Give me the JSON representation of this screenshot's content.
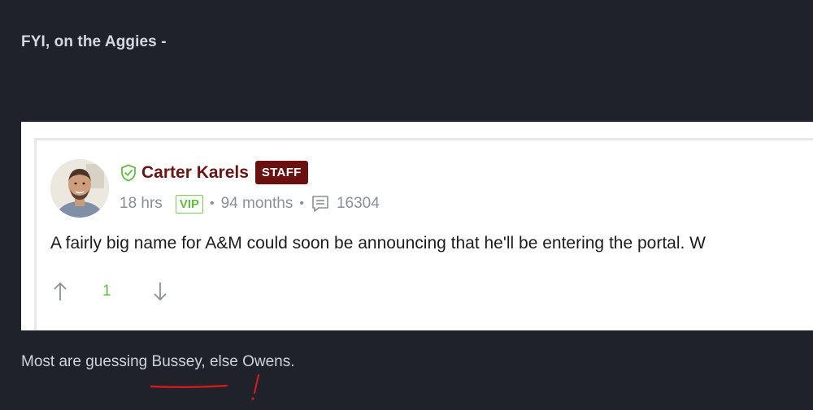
{
  "intro_text": "FYI, on the Aggies -",
  "embed": {
    "author": {
      "name": "Carter Karels",
      "role_badge": "STAFF",
      "verified_icon": "shield-check-icon"
    },
    "meta": {
      "time_ago": "18 hrs",
      "membership_badge": "VIP",
      "tenure": "94 months",
      "post_count": "16304",
      "post_count_icon": "comment-icon",
      "separator": "•"
    },
    "body_text": "A fairly big name for A&M could soon be announcing that he'll be entering the portal. W",
    "votes": {
      "count": "1",
      "upvote_icon": "arrow-up-icon",
      "downvote_icon": "arrow-down-icon"
    }
  },
  "outro_text": "Most are guessing Bussey, else Owens.",
  "colors": {
    "page_background": "#1f222b",
    "author_name": "#6b1414",
    "staff_badge": "#6b0f0f",
    "vip_green": "#5fbf3d",
    "annotation_red": "#d11a1a"
  }
}
